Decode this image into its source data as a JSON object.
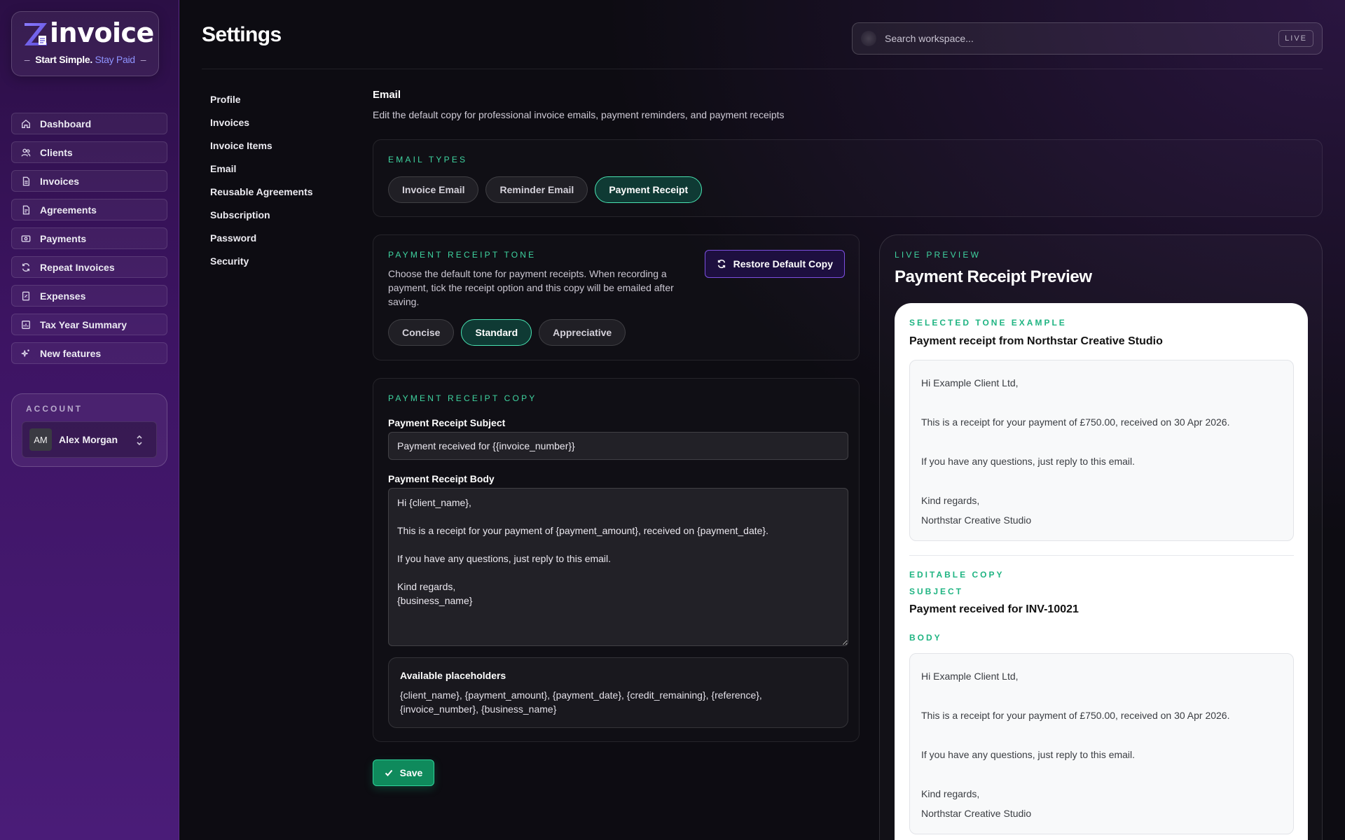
{
  "brand": {
    "logo_text": "invoice",
    "tagline_main": "Start Simple.",
    "tagline_accent": "Stay Paid",
    "tagline_dash_left": "–",
    "tagline_dash_right": "–",
    "accent_color": "#8f93ff"
  },
  "sidebar": {
    "items": [
      {
        "label": "Dashboard",
        "icon": "home-icon"
      },
      {
        "label": "Clients",
        "icon": "users-icon"
      },
      {
        "label": "Invoices",
        "icon": "document-icon"
      },
      {
        "label": "Agreements",
        "icon": "document-icon"
      },
      {
        "label": "Payments",
        "icon": "payment-icon"
      },
      {
        "label": "Repeat Invoices",
        "icon": "repeat-icon"
      },
      {
        "label": "Expenses",
        "icon": "receipt-icon"
      },
      {
        "label": "Tax Year Summary",
        "icon": "chart-icon"
      },
      {
        "label": "New features",
        "icon": "sparkle-icon"
      }
    ],
    "account": {
      "label": "ACCOUNT",
      "initials": "AM",
      "name": "Alex Morgan"
    }
  },
  "header": {
    "title": "Settings",
    "search_placeholder": "Search workspace...",
    "live_badge": "LIVE"
  },
  "subnav": {
    "items": [
      "Profile",
      "Invoices",
      "Invoice Items",
      "Email",
      "Reusable Agreements",
      "Subscription",
      "Password",
      "Security"
    ]
  },
  "section": {
    "title": "Email",
    "description": "Edit the default copy for professional invoice emails, payment reminders, and payment receipts"
  },
  "email_types": {
    "kicker": "EMAIL TYPES",
    "options": [
      "Invoice Email",
      "Reminder Email",
      "Payment Receipt"
    ],
    "selected": "Payment Receipt"
  },
  "tone": {
    "kicker": "PAYMENT RECEIPT TONE",
    "description": "Choose the default tone for payment receipts. When recording a payment, tick the receipt option and this copy will be emailed after saving.",
    "restore_label": "Restore Default Copy",
    "options": [
      "Concise",
      "Standard",
      "Appreciative"
    ],
    "selected": "Standard"
  },
  "copy": {
    "kicker": "PAYMENT RECEIPT COPY",
    "subject_label": "Payment Receipt Subject",
    "subject_value": "Payment received for {{invoice_number}}",
    "body_label": "Payment Receipt Body",
    "body_value": "Hi {client_name},\n\nThis is a receipt for your payment of {payment_amount}, received on {payment_date}.\n\nIf you have any questions, just reply to this email.\n\nKind regards,\n{business_name}",
    "placeholders_title": "Available placeholders",
    "placeholders_list": "{client_name}, {payment_amount}, {payment_date}, {credit_remaining}, {reference}, {invoice_number}, {business_name}"
  },
  "save_label": "Save",
  "preview": {
    "kicker": "LIVE PREVIEW",
    "title": "Payment Receipt Preview",
    "tone_kicker": "SELECTED TONE EXAMPLE",
    "tone_heading": "Payment receipt from Northstar Creative Studio",
    "tone_lines": {
      "greeting": "Hi Example Client Ltd,",
      "receipt": "This is a receipt for your payment of £750.00, received on 30 Apr 2026.",
      "questions": "If you have any questions, just reply to this email.",
      "signoff": "Kind regards,",
      "business": "Northstar Creative Studio"
    },
    "editable_kicker": "EDITABLE COPY",
    "subject_kicker": "SUBJECT",
    "subject_value": "Payment received for INV-10021",
    "body_kicker": "BODY",
    "body_lines": {
      "greeting": "Hi Example Client Ltd,",
      "receipt": "This is a receipt for your payment of £750.00, received on 30 Apr 2026.",
      "questions": "If you have any questions, just reply to this email.",
      "signoff": "Kind regards,",
      "business": "Northstar Creative Studio"
    }
  }
}
